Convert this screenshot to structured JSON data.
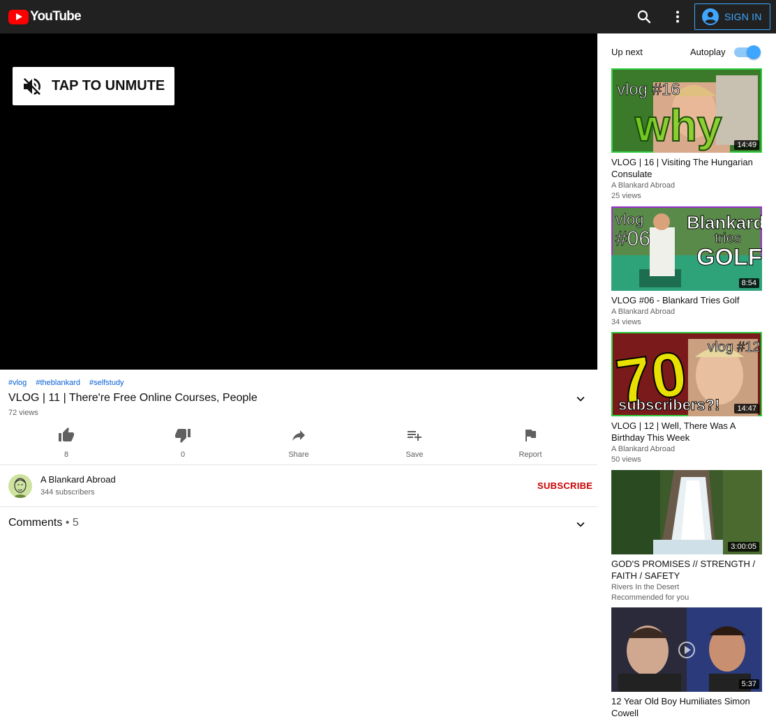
{
  "header": {
    "logo_text": "YouTube",
    "signin_label": "SIGN IN",
    "colors": {
      "bar": "#212121",
      "brand": "#ff0000",
      "accent": "#3ea6ff"
    }
  },
  "player": {
    "unmute_label": "TAP TO UNMUTE"
  },
  "video": {
    "tags": [
      "#vlog",
      "#theblankard",
      "#selfstudy"
    ],
    "title": "VLOG | 11 | There're Free Online Courses, People",
    "views": "72 views",
    "actions": {
      "like_count": "8",
      "dislike_count": "0",
      "share_label": "Share",
      "save_label": "Save",
      "report_label": "Report"
    }
  },
  "channel": {
    "name": "A Blankard Abroad",
    "subscribers": "344 subscribers",
    "subscribe_label": "SUBSCRIBE"
  },
  "comments": {
    "label": "Comments",
    "separator": "•",
    "count": "5"
  },
  "sidebar": {
    "upnext_label": "Up next",
    "autoplay_label": "Autoplay",
    "autoplay_on": true,
    "videos": [
      {
        "duration": "14:49",
        "title": "VLOG | 16 | Visiting The Hungarian Consulate",
        "channel": "A Blankard Abroad",
        "sub": "25 views",
        "thumb_text": [
          "vlog #16",
          "why"
        ]
      },
      {
        "duration": "8:54",
        "title": "VLOG #06 - Blankard Tries Golf",
        "channel": "A Blankard Abroad",
        "sub": "34 views",
        "thumb_text": [
          "vlog",
          "#06",
          "Blankard",
          "tries",
          "GOLF"
        ]
      },
      {
        "duration": "14:47",
        "title": "VLOG | 12 | Well, There Was A Birthday This Week",
        "channel": "A Blankard Abroad",
        "sub": "50 views",
        "thumb_text": [
          "vlog #12",
          "70",
          "subscribers?!"
        ]
      },
      {
        "duration": "3:00:05",
        "title": "GOD'S PROMISES // STRENGTH / FAITH / SAFETY",
        "channel": "Rivers In the Desert",
        "sub": "Recommended for you"
      },
      {
        "duration": "5:37",
        "title": "12 Year Old Boy Humiliates Simon Cowell",
        "channel": "",
        "sub": ""
      }
    ]
  }
}
